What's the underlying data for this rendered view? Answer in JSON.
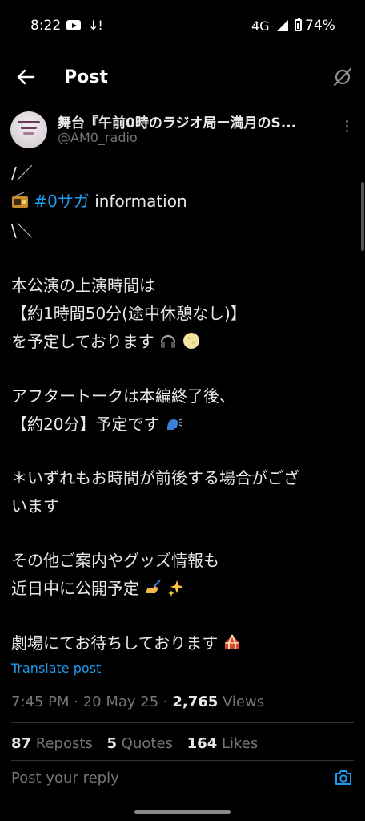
{
  "status_bar": {
    "time": "8:22",
    "notif_icons": "↓!",
    "network": "4G",
    "battery": "74%"
  },
  "nav": {
    "title": "Post"
  },
  "author": {
    "name": "舞台『午前0時のラジオ局ー満月のS...",
    "handle": "@AM0_radio"
  },
  "post": {
    "line1": "/／",
    "line2_hashtag": "#0サガ",
    "line2_text": " information",
    "line3": "\\＼",
    "p1_l1": "本公演の上演時間は",
    "p1_l2": "【約1時間50分(途中休憩なし)】",
    "p1_l3": "を予定しております",
    "p2_l1": "アフタートークは本編終了後、",
    "p2_l2": "【約20分】予定です",
    "p3_l1": "＊いずれもお時間が前後する場合がござ",
    "p3_l2": "います",
    "p4_l1": "その他ご案内やグッズ情報も",
    "p4_l2": "近日中に公開予定",
    "p5_l1": "劇場にてお待ちしております"
  },
  "translate_label": "Translate post",
  "meta": {
    "time_date": "7:45 PM · 20 May 25 · ",
    "views_count": "2,765",
    "views_label": " Views"
  },
  "stats": {
    "reposts_count": "87",
    "reposts_label": " Reposts",
    "quotes_count": "5",
    "quotes_label": " Quotes",
    "likes_count": "164",
    "likes_label": " Likes"
  },
  "reply_placeholder": "Post your reply",
  "icons": {
    "back": "arrow-left-icon",
    "grok": "grok-icon",
    "more": "more-vertical-icon",
    "camera": "camera-icon",
    "radio": "radio-icon",
    "headphones": "headphones-icon",
    "moon": "full-moon-icon",
    "speaking": "speaking-head-icon",
    "writing": "writing-hand-icon",
    "sparkles": "sparkles-icon",
    "circus": "circus-tent-icon"
  },
  "colors": {
    "accent": "#1d9bf0",
    "background": "#000000",
    "text": "#e7e9ea",
    "muted": "#71767b"
  }
}
